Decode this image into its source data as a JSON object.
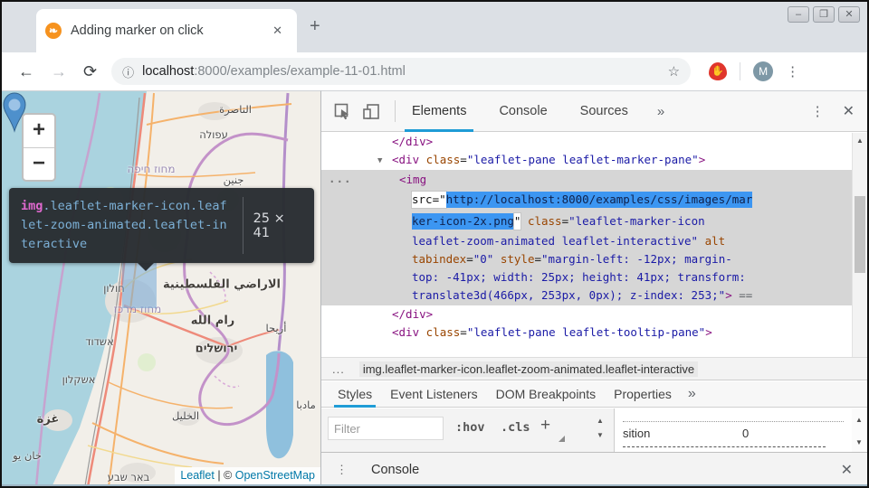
{
  "window": {
    "minimize": "–",
    "maximize": "❐",
    "close": "✕"
  },
  "tab": {
    "favicon_glyph": "❧",
    "title": "Adding marker on click",
    "close": "✕",
    "new_tab": "+"
  },
  "toolbar": {
    "back": "←",
    "forward": "→",
    "reload": "⟳",
    "info": "ⓘ",
    "url_host": "localhost",
    "url_rest": ":8000/examples/example-11-01.html",
    "star": "☆",
    "ublock": "✋",
    "avatar": "M",
    "menu": "⋮"
  },
  "map": {
    "zoom_in": "+",
    "zoom_out": "−",
    "tooltip": {
      "tag": "img",
      "classes": ".leaflet-marker-icon.leaflet-zoom-animated.leaflet-interactive",
      "size": "25 × 41"
    },
    "attribution": {
      "leaflet": "Leaflet",
      "sep": " | © ",
      "osm": "OpenStreetMap"
    },
    "labels": [
      {
        "text": "الناصرة"
      },
      {
        "text": "עפולה"
      },
      {
        "text": "מחוז חיפה"
      },
      {
        "text": "جنين"
      },
      {
        "text": "חולון"
      },
      {
        "text": "מחוז מרכז"
      },
      {
        "text": "الاراضي الفلسطينية"
      },
      {
        "text": "رام الله"
      },
      {
        "text": "أريحا"
      },
      {
        "text": "ירושלים"
      },
      {
        "text": "אשדוד"
      },
      {
        "text": "אשקלון"
      },
      {
        "text": "الخليل"
      },
      {
        "text": "مادبا"
      },
      {
        "text": "غزة"
      },
      {
        "text": "خان يو"
      },
      {
        "text": "באר שבע"
      }
    ]
  },
  "devtools": {
    "tabs": [
      "Elements",
      "Console",
      "Sources"
    ],
    "more": "»",
    "menu": "⋮",
    "close": "✕",
    "scroll_up": "▲",
    "scroll_down": "▼",
    "code": {
      "l1": "</div>",
      "arrow": "▼",
      "l2_tag": "<div",
      "attr_class": "class",
      "eq": "=",
      "l2_val": "\"leaflet-pane leaflet-marker-pane\"",
      "bracket": ">",
      "gutter": "...",
      "l3": "<img",
      "src_label": "src=\"",
      "src_sel1": "http://localhost:8000/examples/css/images/mar",
      "src_sel2": "ker-icon-2x.png",
      "endq": "\"",
      "l5_val": "\"leaflet-marker-icon",
      "l6_val": "leaflet-zoom-animated leaflet-interactive\"",
      "attr_alt": "alt",
      "attr_tabindex": "tabindex",
      "tabindex_val": "\"0\"",
      "attr_style": "style",
      "style_v1": "\"margin-left: -12px; margin-",
      "style_v2": "top: -41px; width: 25px; height: 41px; transform:",
      "style_v3": "translate3d(466px, 253px, 0px); z-index: 253;\"",
      "eq_marker": "==",
      "l10": "</div>",
      "l11_tag": "<div",
      "l11_val": "\"leaflet-pane leaflet-tooltip-pane\""
    },
    "breadcrumb": {
      "ellipsis": "...",
      "selector": "img.leaflet-marker-icon.leaflet-zoom-animated.leaflet-interactive"
    },
    "sidebar_tabs": [
      "Styles",
      "Event Listeners",
      "DOM Breakpoints",
      "Properties"
    ],
    "sidebar_more": "»",
    "filter_placeholder": "Filter",
    "hov": ":hov",
    "cls": ".cls",
    "plus": "+",
    "metrics": {
      "label": "sition",
      "value": "0"
    },
    "console": {
      "menu": "⋮",
      "label": "Console",
      "close": "✕"
    }
  }
}
